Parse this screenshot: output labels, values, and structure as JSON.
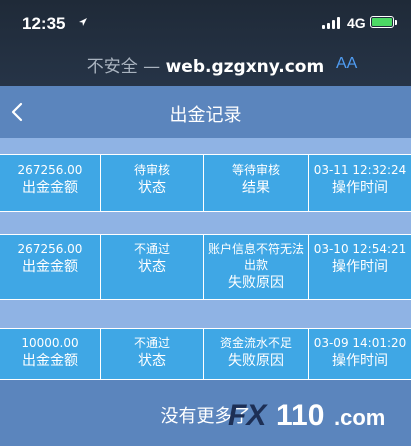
{
  "status_bar": {
    "time": "12:35",
    "network": "4G"
  },
  "browser": {
    "insecure_label": "不安全 — ",
    "domain": "web.gzgxny.com",
    "aa_label": "AA"
  },
  "header": {
    "title": "出金记录"
  },
  "records": [
    {
      "amount": "267256.00",
      "amount_label": "出金金额",
      "status": "待审核",
      "status_label": "状态",
      "result": "等待审核",
      "result_label": "结果",
      "time": "03-11 12:32:24",
      "time_label": "操作时间"
    },
    {
      "amount": "267256.00",
      "amount_label": "出金金额",
      "status": "不通过",
      "status_label": "状态",
      "result": "账户信息不符无法出款",
      "result_label": "失败原因",
      "time": "03-10 12:54:21",
      "time_label": "操作时间"
    },
    {
      "amount": "10000.00",
      "amount_label": "出金金额",
      "status": "不通过",
      "status_label": "状态",
      "result": "资金流水不足",
      "result_label": "失败原因",
      "time": "03-09 14:01:20",
      "time_label": "操作时间"
    }
  ],
  "footer": {
    "text": "没有更多了"
  },
  "watermark": {
    "fx": "FX",
    "num": "110",
    "suffix": ".com"
  }
}
